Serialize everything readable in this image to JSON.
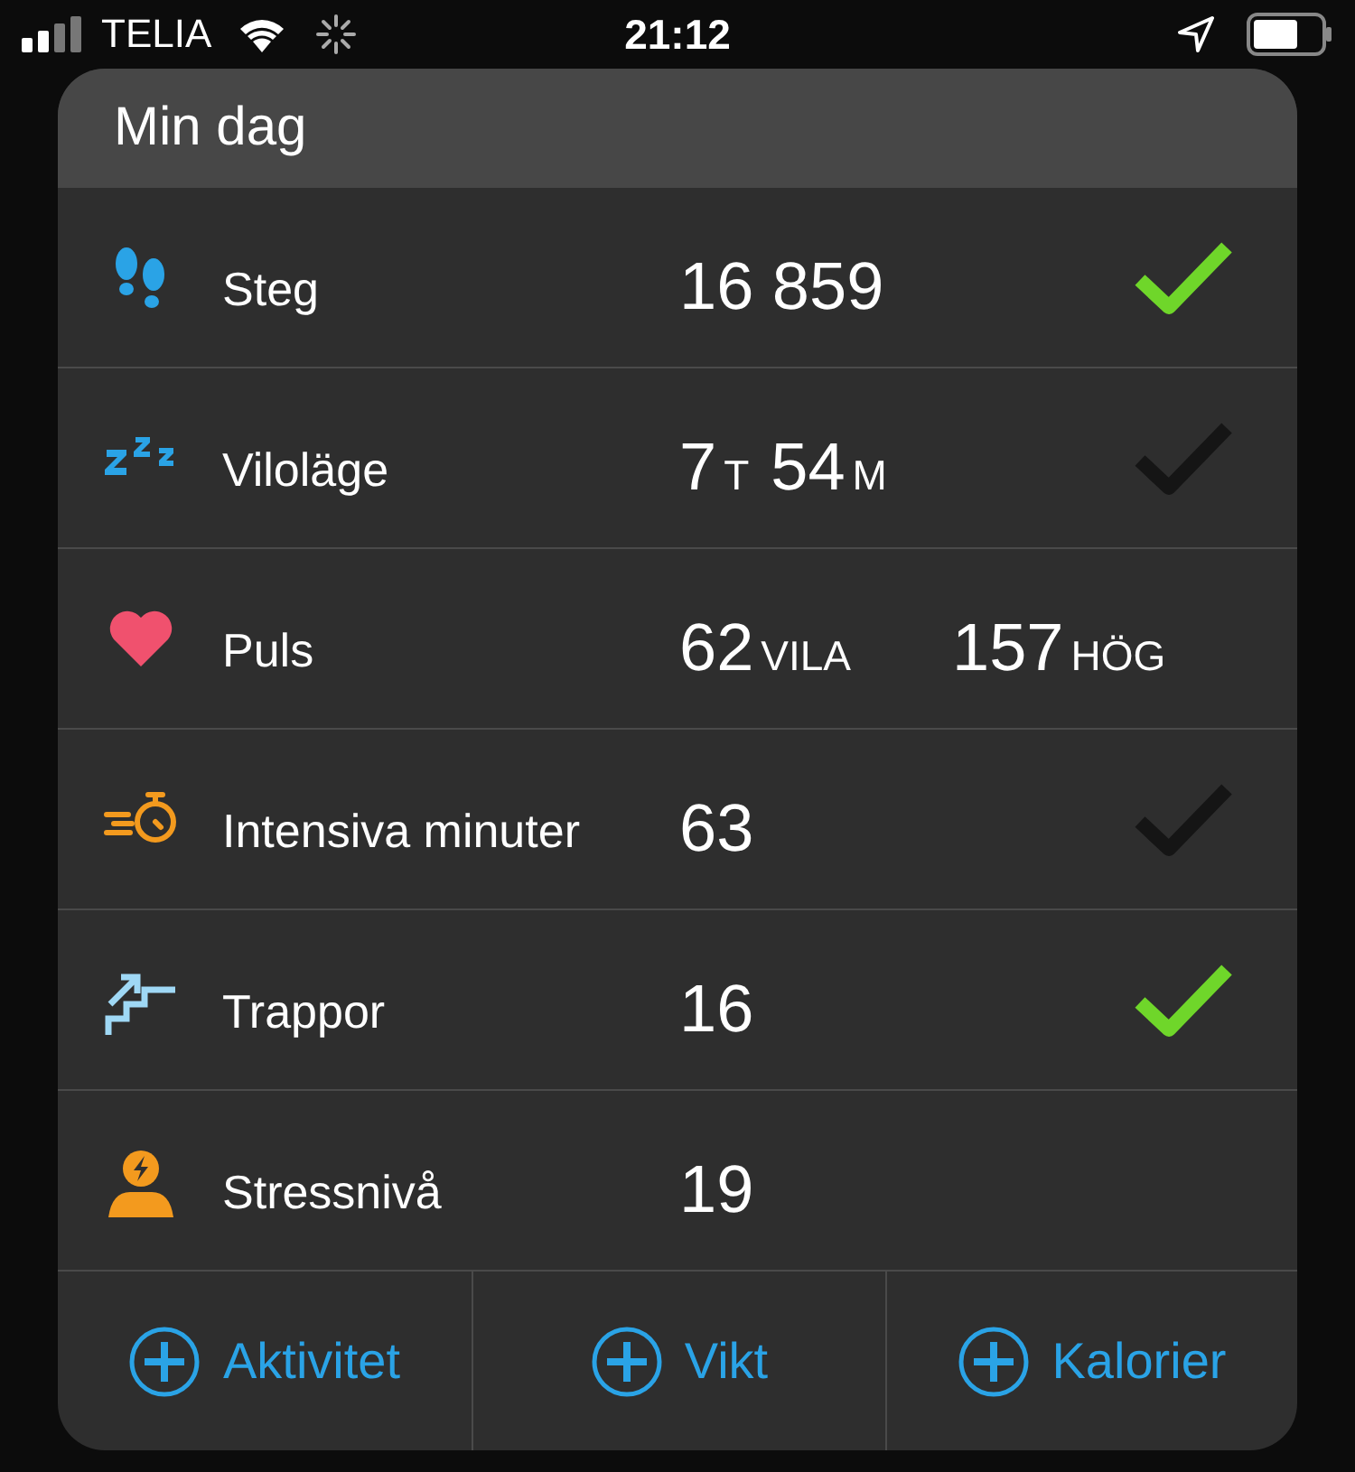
{
  "status_bar": {
    "carrier": "TELIA",
    "time": "21:12"
  },
  "card": {
    "title": "Min dag",
    "rows": [
      {
        "kind": "steps",
        "label": "Steg",
        "values": [
          {
            "number": "16 859"
          }
        ],
        "goal_met": true
      },
      {
        "kind": "sleep",
        "label": "Viloläge",
        "values": [
          {
            "number": "7",
            "unit": "T"
          },
          {
            "number": "54",
            "unit": "M"
          }
        ],
        "goal_met": false
      },
      {
        "kind": "heart",
        "label": "Puls",
        "values": [
          {
            "number": "62",
            "unit": "VILA"
          },
          {
            "number": "157",
            "unit": "HÖG"
          }
        ]
      },
      {
        "kind": "stopwatch",
        "label": "Intensiva minuter",
        "values": [
          {
            "number": "63"
          }
        ],
        "goal_met": false
      },
      {
        "kind": "stairs",
        "label": "Trappor",
        "values": [
          {
            "number": "16"
          }
        ],
        "goal_met": true
      },
      {
        "kind": "stress",
        "label": "Stressnivå",
        "values": [
          {
            "number": "19"
          }
        ]
      }
    ],
    "actions": [
      {
        "label": "Aktivitet"
      },
      {
        "label": "Vikt"
      },
      {
        "label": "Kalorier"
      }
    ]
  }
}
